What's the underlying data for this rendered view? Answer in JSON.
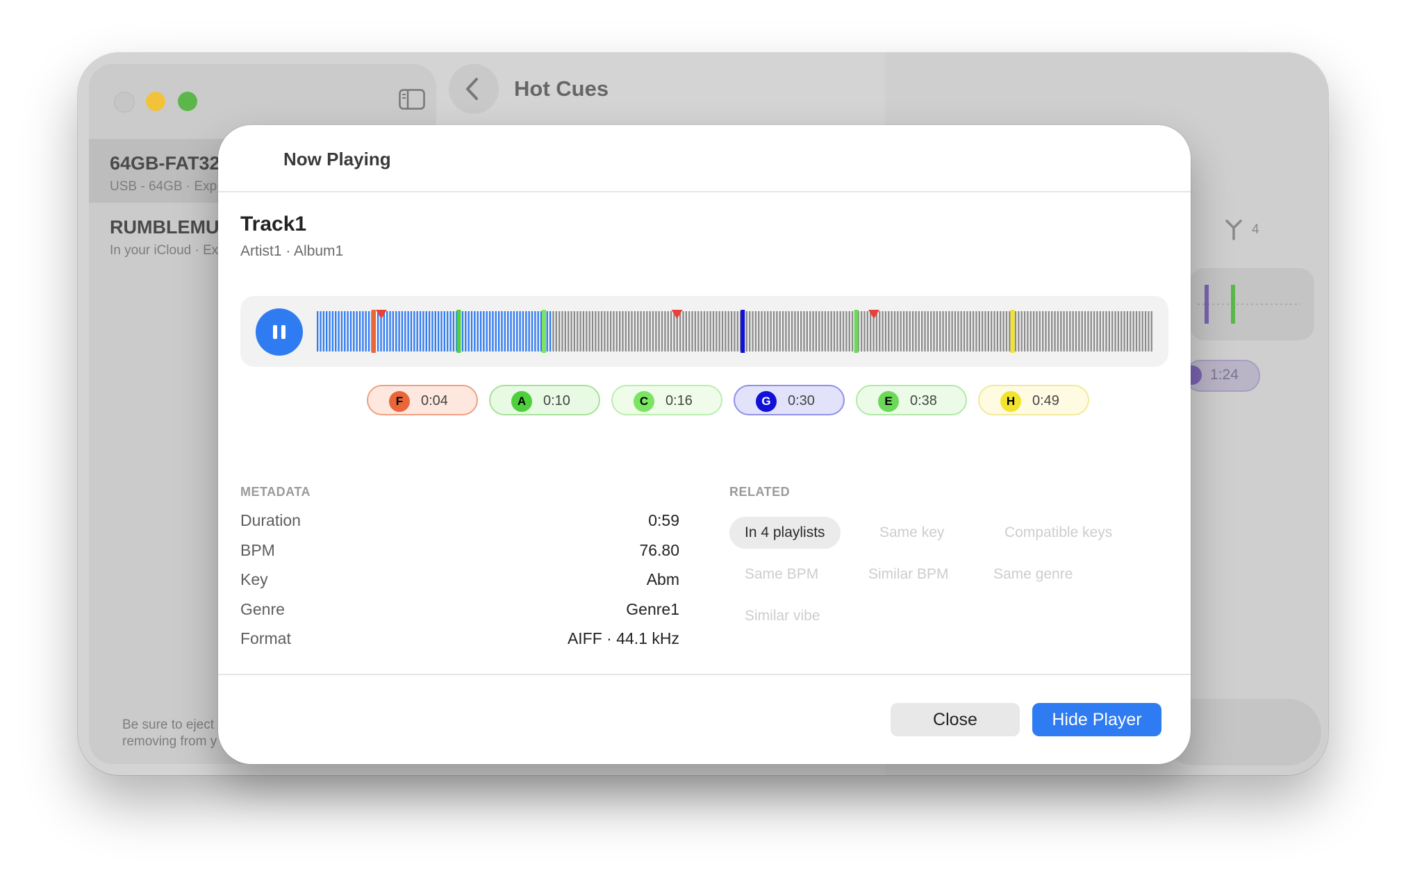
{
  "window": {
    "title": "Hot Cues"
  },
  "sidebar": {
    "devices": [
      {
        "name": "64GB-FAT32",
        "subtitle": "USB - 64GB · Exp"
      },
      {
        "name": "RUMBLEMUN",
        "subtitle": "In your iCloud · Ex"
      }
    ],
    "eject_note_lines": [
      "Be sure to eject",
      "removing from y"
    ]
  },
  "background": {
    "filter_count": "4",
    "cue_pill_time": "1:24"
  },
  "modal": {
    "header_title": "Now Playing",
    "track": {
      "title": "Track1",
      "subtitle": "Artist1 · Album1"
    },
    "player": {
      "state": "playing",
      "progress_fraction": 0.28,
      "accent": "#2f7bf2"
    },
    "hot_cues": [
      {
        "letter": "F",
        "time": "0:04",
        "color": "#e8663a",
        "bg": "#fde7df",
        "border": "#f0a080",
        "text_color": "#000000"
      },
      {
        "letter": "A",
        "time": "0:10",
        "color": "#4fcf3c",
        "bg": "#e8f9e4",
        "border": "#a5e397",
        "text_color": "#000000"
      },
      {
        "letter": "C",
        "time": "0:16",
        "color": "#7be463",
        "bg": "#eefce9",
        "border": "#b9efac",
        "text_color": "#000000"
      },
      {
        "letter": "G",
        "time": "0:30",
        "color": "#1010d8",
        "bg": "#e2e2fb",
        "border": "#8f8fe8",
        "text_color": "#ffffff"
      },
      {
        "letter": "E",
        "time": "0:38",
        "color": "#6bd957",
        "bg": "#ecfbe8",
        "border": "#b0eaa4",
        "text_color": "#000000"
      },
      {
        "letter": "H",
        "time": "0:49",
        "color": "#f2e32e",
        "bg": "#fefbe2",
        "border": "#f1e99a",
        "text_color": "#000000"
      }
    ],
    "metadata": {
      "label": "METADATA",
      "rows": [
        {
          "key": "Duration",
          "value": "0:59"
        },
        {
          "key": "BPM",
          "value": "76.80"
        },
        {
          "key": "Key",
          "value": "Abm"
        },
        {
          "key": "Genre",
          "value": "Genre1"
        },
        {
          "key": "Format",
          "value": "AIFF · 44.1 kHz"
        }
      ]
    },
    "related": {
      "label": "RELATED",
      "items": [
        {
          "label": "In 4 playlists",
          "active": true
        },
        {
          "label": "Same key",
          "active": false
        },
        {
          "label": "Compatible keys",
          "active": false
        },
        {
          "label": "Same BPM",
          "active": false
        },
        {
          "label": "Similar BPM",
          "active": false
        },
        {
          "label": "Same genre",
          "active": false
        },
        {
          "label": "Similar vibe",
          "active": false
        }
      ]
    },
    "buttons": {
      "close": "Close",
      "hide_player": "Hide Player"
    }
  }
}
